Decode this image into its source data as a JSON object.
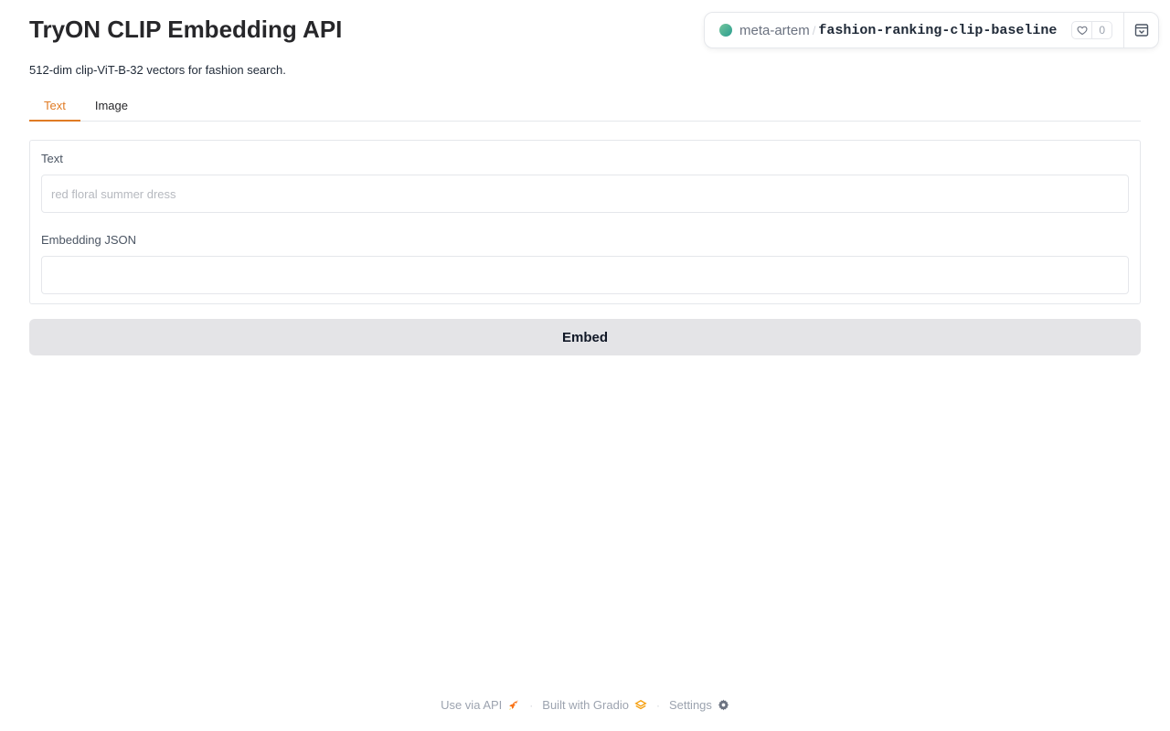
{
  "header": {
    "title": "TryON CLIP Embedding API",
    "description": "512-dim clip-ViT-B-32 vectors for fashion search."
  },
  "space": {
    "owner": "meta-artem",
    "separator": "/",
    "repo": "fashion-ranking-clip-baseline",
    "likes": "0"
  },
  "tabs": [
    {
      "label": "Text",
      "active": true
    },
    {
      "label": "Image",
      "active": false
    }
  ],
  "form": {
    "text_label": "Text",
    "text_placeholder": "red floral summer dress",
    "text_value": "",
    "output_label": "Embedding JSON",
    "output_value": ""
  },
  "actions": {
    "embed_label": "Embed"
  },
  "footer": {
    "api_label": "Use via API",
    "gradio_label": "Built with Gradio",
    "settings_label": "Settings",
    "separator": "·"
  },
  "colors": {
    "accent": "#e07b24",
    "button_bg": "#e4e4e7"
  }
}
